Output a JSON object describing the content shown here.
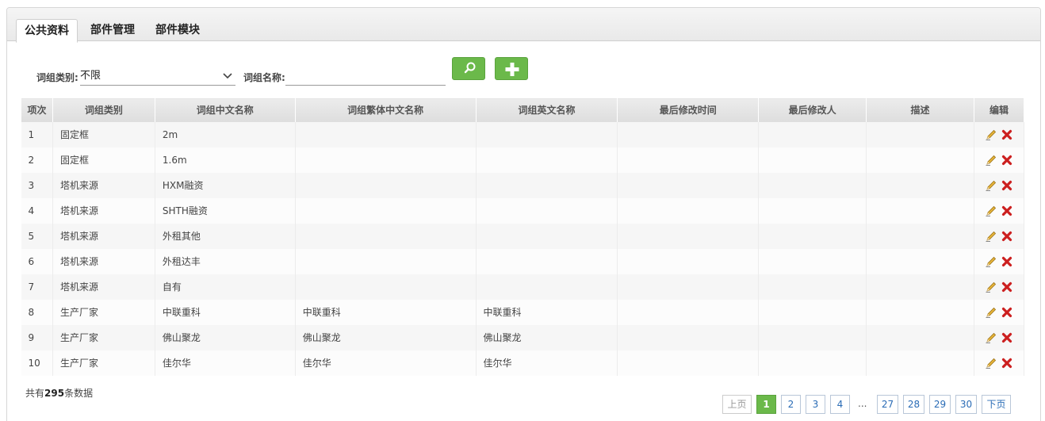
{
  "tabs": [
    "公共资料",
    "部件管理",
    "部件模块"
  ],
  "filters": {
    "category_label": "词组类别:",
    "category_value": "不限",
    "name_label": "词组名称:",
    "name_value": ""
  },
  "table": {
    "headers": [
      "项次",
      "词组类别",
      "词组中文名称",
      "词组繁体中文名称",
      "词组英文名称",
      "最后修改时间",
      "最后修改人",
      "描述",
      "编辑"
    ],
    "rows": [
      [
        "1",
        "固定框",
        "2m",
        "",
        "",
        "",
        "",
        ""
      ],
      [
        "2",
        "固定框",
        "1.6m",
        "",
        "",
        "",
        "",
        ""
      ],
      [
        "3",
        "塔机来源",
        "HXM融资",
        "",
        "",
        "",
        "",
        ""
      ],
      [
        "4",
        "塔机来源",
        "SHTH融资",
        "",
        "",
        "",
        "",
        ""
      ],
      [
        "5",
        "塔机来源",
        "外租其他",
        "",
        "",
        "",
        "",
        ""
      ],
      [
        "6",
        "塔机来源",
        "外租达丰",
        "",
        "",
        "",
        "",
        ""
      ],
      [
        "7",
        "塔机来源",
        "自有",
        "",
        "",
        "",
        "",
        ""
      ],
      [
        "8",
        "生产厂家",
        "中联重科",
        "中联重科",
        "中联重科",
        "",
        "",
        ""
      ],
      [
        "9",
        "生产厂家",
        "佛山聚龙",
        "佛山聚龙",
        "佛山聚龙",
        "",
        "",
        ""
      ],
      [
        "10",
        "生产厂家",
        "佳尔华",
        "佳尔华",
        "佳尔华",
        "",
        "",
        ""
      ]
    ]
  },
  "summary": {
    "prefix": "共有",
    "count": "295",
    "suffix": "条数据"
  },
  "pagination": {
    "prev": "上页",
    "next": "下页",
    "pages_left": [
      "1",
      "2",
      "3",
      "4"
    ],
    "ellipsis": "...",
    "pages_right": [
      "27",
      "28",
      "29",
      "30"
    ],
    "current": "1"
  },
  "colors": {
    "accent": "#6bb94a",
    "link": "#2a6cb6",
    "delete": "#cc1f1f"
  },
  "icons": {
    "search": "search-icon",
    "add": "plus-icon",
    "edit": "pencil-icon",
    "delete": "delete-x-icon",
    "dropdown": "chevron-down-icon"
  }
}
